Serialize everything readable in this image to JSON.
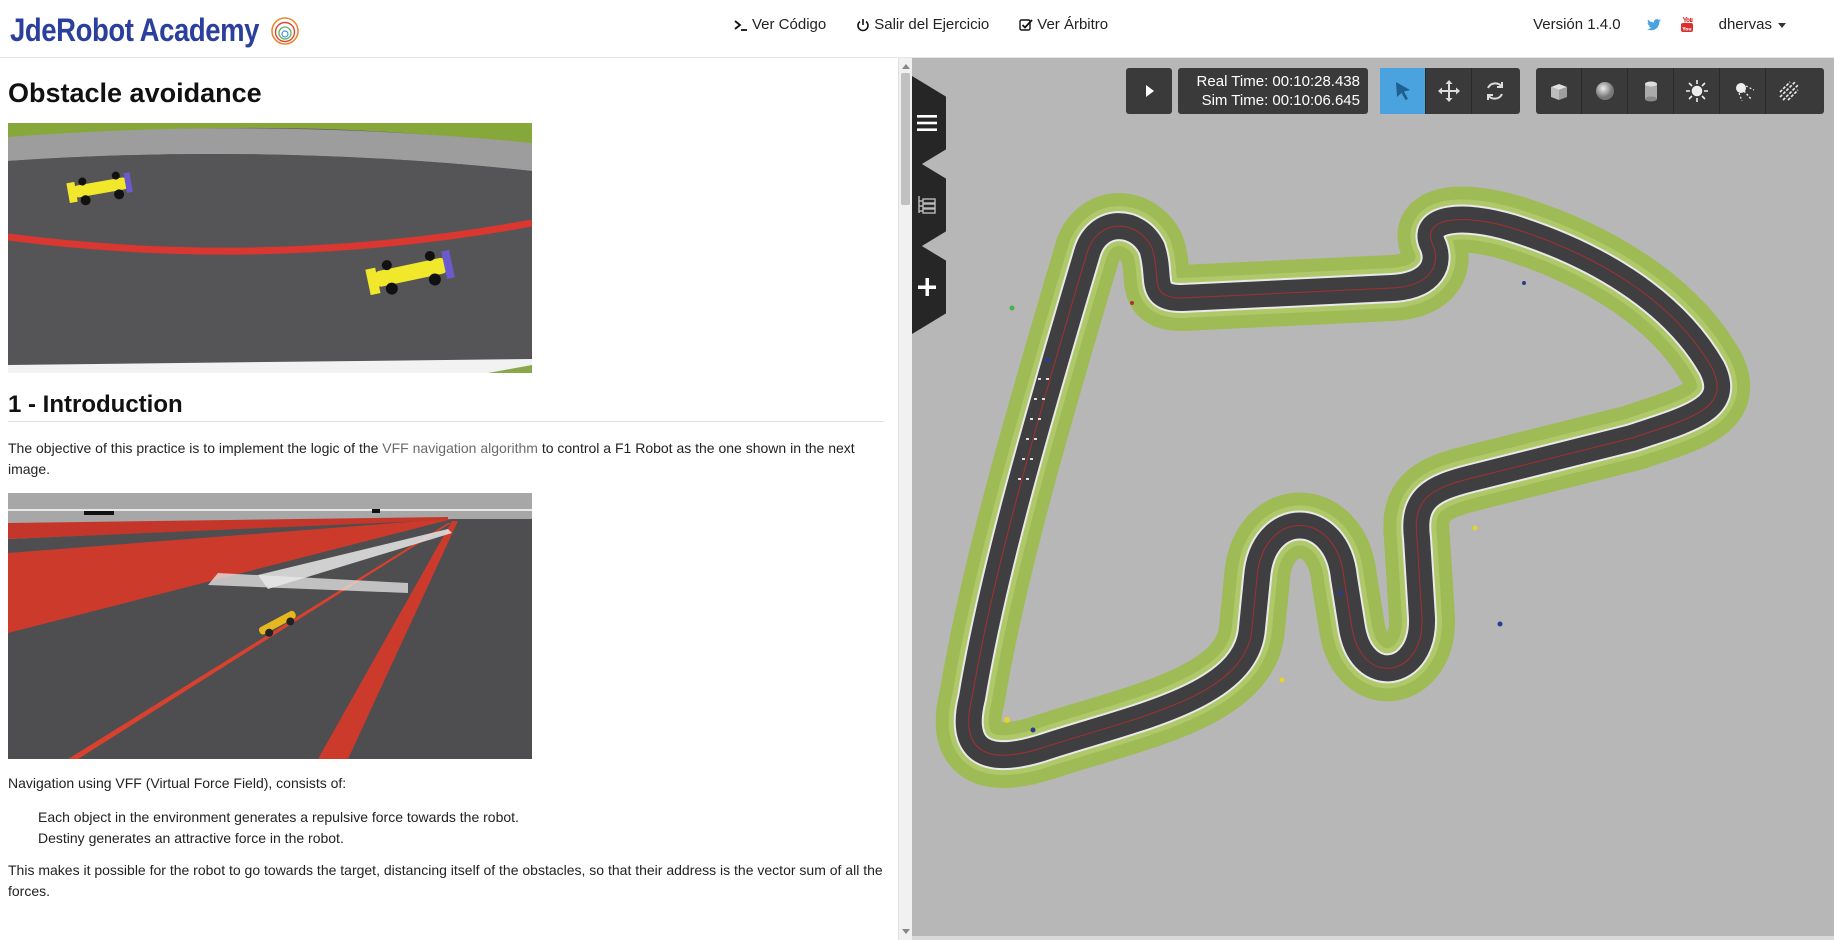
{
  "navbar": {
    "brand": "JdeRobot Academy",
    "links": [
      {
        "label": "Ver Código",
        "icon": "terminal-icon"
      },
      {
        "label": "Salir del Ejercicio",
        "icon": "power-icon"
      },
      {
        "label": "Ver Árbitro",
        "icon": "checkbox-icon"
      }
    ],
    "version": "Versión 1.4.0",
    "user": "dhervas"
  },
  "content": {
    "title": "Obstacle avoidance",
    "section1": {
      "heading": "1 - Introduction",
      "p1_before": "The objective of this practice is to implement the logic of the ",
      "p1_link": "VFF navigation algorithm",
      "p1_after": " to control a F1 Robot as the one shown in the next image.",
      "p2": "Navigation using VFF (Virtual Force Field), consists of:",
      "list": [
        "Each object in the environment generates a repulsive force towards the robot.",
        "Destiny generates an attractive force in the robot."
      ],
      "p3": "This makes it possible for the robot to go towards the target, distancing itself of the obstacles, so that their address is the vector sum of all the forces."
    }
  },
  "simulator": {
    "real_time": "Real Time: 00:10:28.438",
    "sim_time": "Sim Time: 00:10:06.645",
    "tools": [
      "play-icon",
      "select-arrow-icon",
      "translate-icon",
      "rotate-icon",
      "box-icon",
      "sphere-icon",
      "cylinder-icon",
      "point-light-icon",
      "spot-light-icon",
      "directional-light-icon"
    ],
    "side_tabs": [
      "menu-icon",
      "tree-icon",
      "plus-icon"
    ]
  },
  "colors": {
    "brand": "#2b3f9c",
    "sim_bg": "#b7b7b7",
    "grass": "#9fbb55",
    "track": "#3f3f42",
    "active_tool": "#4aa3df"
  }
}
